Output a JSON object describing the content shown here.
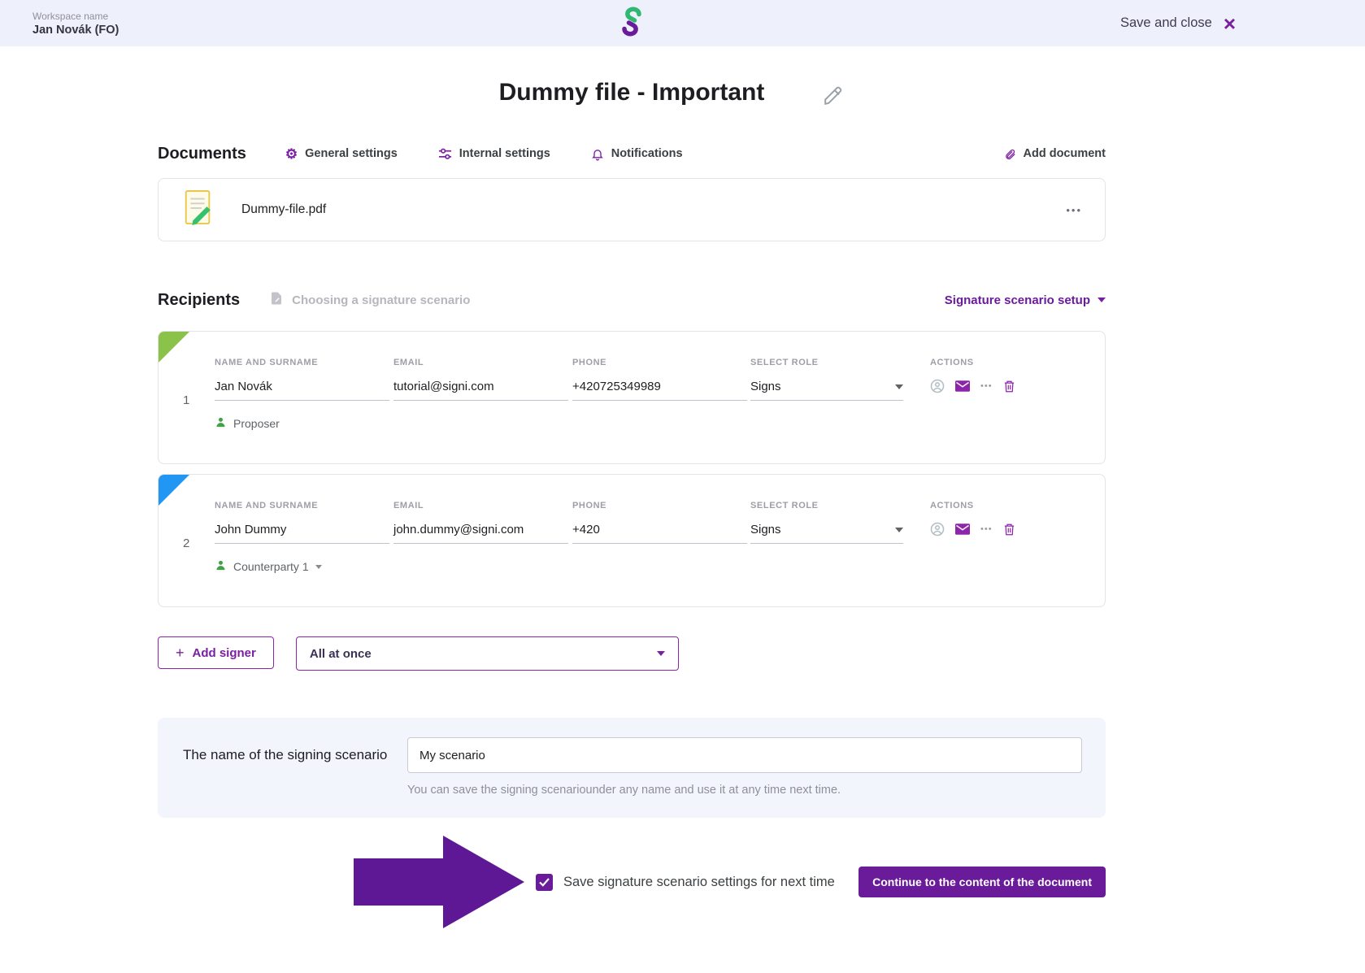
{
  "header": {
    "workspace_label": "Workspace name",
    "workspace_user": "Jan Novák (FO)",
    "save_and_close": "Save and close"
  },
  "page": {
    "title": "Dummy file - Important"
  },
  "documents": {
    "heading": "Documents",
    "tabs": [
      {
        "label": "General settings",
        "icon": "gear-icon"
      },
      {
        "label": "Internal settings",
        "icon": "sliders-icon"
      },
      {
        "label": "Notifications",
        "icon": "bell-icon"
      }
    ],
    "add_document": "Add document",
    "files": [
      {
        "name": "Dummy-file.pdf"
      }
    ]
  },
  "recipients": {
    "heading": "Recipients",
    "subheading": "Choosing a signature scenario",
    "scenario_setup": "Signature scenario setup",
    "columns": {
      "name": "NAME AND SURNAME",
      "email": "EMAIL",
      "phone": "PHONE",
      "role": "SELECT ROLE",
      "actions": "ACTIONS"
    },
    "rows": [
      {
        "index": "1",
        "name": "Jan Novák",
        "email": "tutorial@signi.com",
        "phone": "+420725349989",
        "role": "Signs",
        "tag": "Proposer",
        "corner_color": "#8bc34a"
      },
      {
        "index": "2",
        "name": "John Dummy",
        "email": "john.dummy@signi.com",
        "phone": "+420",
        "role": "Signs",
        "tag": "Counterparty 1",
        "corner_color": "#2196f3"
      }
    ],
    "add_signer": "Add signer",
    "order_select": "All at once"
  },
  "scenario": {
    "label": "The name of the signing scenario",
    "value": "My scenario",
    "helper": "You can save the signing scenariounder any name and use it at any time next time."
  },
  "footer": {
    "checkbox_label": "Save signature scenario settings for next time",
    "continue_button": "Continue to the content of the document"
  },
  "icons": {
    "gear": "⚙",
    "close": "×",
    "plus": "+",
    "menu": "•••",
    "more": "•••"
  },
  "colors": {
    "accent": "#7b1fa2",
    "accent_dark": "#6a1b9a",
    "arrow": "#5e1895",
    "logo_green": "#2eb873",
    "person_green": "#43a047",
    "header_bg": "#eef1fb",
    "panel_bg": "#f2f5fc"
  }
}
